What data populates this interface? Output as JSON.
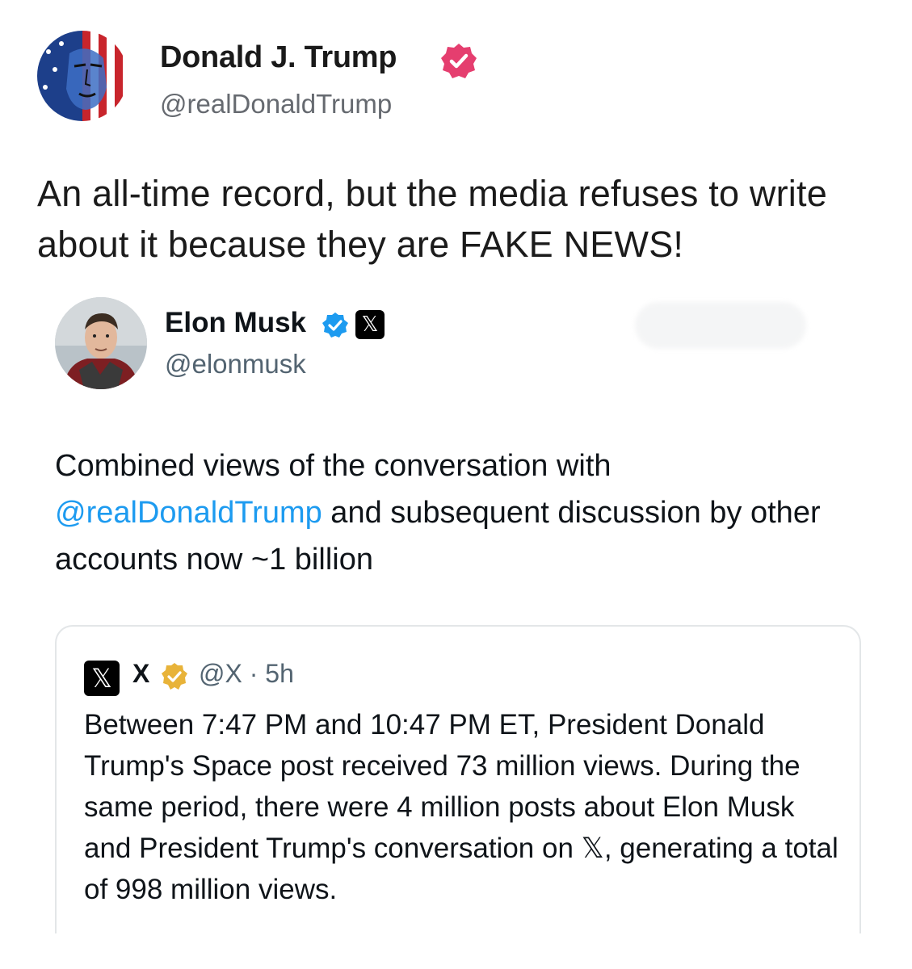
{
  "post": {
    "author_name": "Donald J. Trump",
    "author_handle": "@realDonaldTrump",
    "text": "An all-time record, but the media refuses to write about it because they are FAKE NEWS!",
    "verified_color": "#e53e6f"
  },
  "embedded_tweet": {
    "author_name": "Elon Musk",
    "author_handle": "@elonmusk",
    "verified_color": "#1d9bf0",
    "affiliate_badge": "𝕏",
    "text_part1": "Combined views of the conversation with ",
    "mention": "@realDonaldTrump",
    "text_part2": " and subsequent discussion by other accounts now ~1 billion",
    "quoted": {
      "logo": "𝕏",
      "name": "X",
      "verified_color": "#e8b339",
      "handle_time": "@X · 5h",
      "text": "Between 7:47 PM and 10:47 PM ET, President Donald Trump's Space post received 73 million views. During the same period, there were 4 million posts about Elon Musk and President Trump's conversation on 𝕏, generating a total of 998 million views."
    }
  }
}
